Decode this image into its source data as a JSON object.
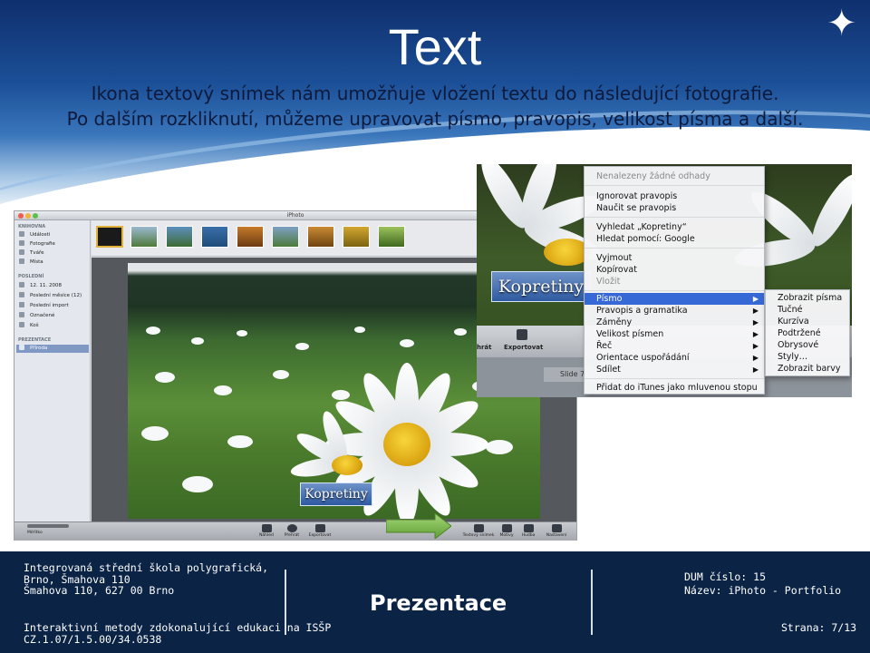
{
  "slide": {
    "title": "Text",
    "subtitle_line1": "Ikona textový snímek nám umožňuje vložení textu do následující fotografie.",
    "subtitle_line2": "Po dalším rozkliknutí, můžeme upravovat písmo, pravopis, velikost písma a další."
  },
  "iphoto": {
    "window_title": "iPhoto",
    "sidebar": {
      "library_header": "KNIHOVNA",
      "library_items": [
        "Události",
        "Fotografie",
        "Tváře",
        "Místa"
      ],
      "recent_header": "POSLEDNÍ",
      "recent_items": [
        "12. 11. 2008",
        "Poslední měsíce (12)",
        "Poslední import",
        "Označené",
        "Koš"
      ],
      "presentations_header": "PREZENTACE",
      "presentations_items": [
        "Příroda"
      ]
    },
    "photo_label": "Kopretiny",
    "toolbar": {
      "zoom_label": "Měřítko",
      "buttons": [
        "Náhled",
        "Přehrát",
        "Exportovat",
        "Textový snímek",
        "Motivy",
        "Hudba",
        "Nastavení"
      ]
    }
  },
  "context_shot": {
    "photo_label": "Kopretiny",
    "bar_left_label": "hrát",
    "bar_export_label": "Exportovat",
    "slide_label": "Slide 7",
    "menu_items": [
      {
        "label": "Nenalezeny žádné odhady",
        "state": "disabled"
      },
      {
        "label": "Ignorovat pravopis"
      },
      {
        "label": "Naučit se pravopis"
      },
      {
        "label": "Vyhledat „Kopretiny“"
      },
      {
        "label": "Hledat pomocí: Google"
      },
      {
        "label": "Vyjmout"
      },
      {
        "label": "Kopírovat"
      },
      {
        "label": "Vložit",
        "state": "disabled"
      },
      {
        "label": "Písmo",
        "state": "highlighted",
        "submenu": true
      },
      {
        "label": "Pravopis a gramatika",
        "submenu": true
      },
      {
        "label": "Záměny",
        "submenu": true
      },
      {
        "label": "Velikost písmen",
        "submenu": true
      },
      {
        "label": "Řeč",
        "submenu": true
      },
      {
        "label": "Orientace uspořádání",
        "submenu": true
      },
      {
        "label": "Sdílet",
        "submenu": true
      },
      {
        "label": "Přidat do iTunes jako mluvenou stopu"
      }
    ],
    "submenu_items": [
      "Zobrazit písma",
      "Tučné",
      "Kurzíva",
      "Podtržené",
      "Obrysové",
      "Styly…",
      "Zobrazit barvy"
    ]
  },
  "footer": {
    "school_line1": "Integrovaná střední škola polygrafická,",
    "school_line2": "Brno, Šmahova 110",
    "school_line3": "Šmahova 110, 627 00 Brno",
    "program_line1": "Interaktivní metody zdokonalující edukaci na ISŠP",
    "program_line2": "CZ.1.07/1.5.00/34.0538",
    "center_title": "Prezentace",
    "dum_line": "DUM číslo: 15",
    "name_line": "Název: iPhoto - Portfolio",
    "page_line": "Strana: 7/13"
  },
  "colors": {
    "footer_bg": "#0b2345",
    "menu_highlight": "#3668d6",
    "header_blue": "#1b4f97"
  }
}
